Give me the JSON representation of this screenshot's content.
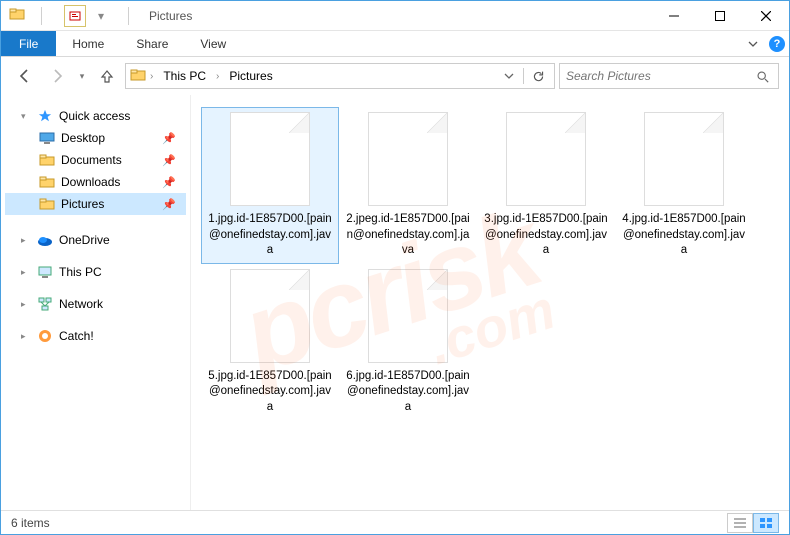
{
  "window": {
    "title": "Pictures"
  },
  "ribbon": {
    "file": "File",
    "tabs": [
      "Home",
      "Share",
      "View"
    ]
  },
  "address": {
    "crumbs": [
      "This PC",
      "Pictures"
    ]
  },
  "search": {
    "placeholder": "Search Pictures"
  },
  "sidebar": {
    "quick_access": {
      "label": "Quick access",
      "items": [
        {
          "label": "Desktop",
          "icon": "desktop",
          "pinned": true
        },
        {
          "label": "Documents",
          "icon": "folder",
          "pinned": true
        },
        {
          "label": "Downloads",
          "icon": "folder",
          "pinned": true
        },
        {
          "label": "Pictures",
          "icon": "folder",
          "pinned": true,
          "selected": true
        }
      ]
    },
    "roots": [
      {
        "label": "OneDrive",
        "icon": "onedrive"
      },
      {
        "label": "This PC",
        "icon": "thispc"
      },
      {
        "label": "Network",
        "icon": "network"
      },
      {
        "label": "Catch!",
        "icon": "catch"
      }
    ]
  },
  "files": [
    {
      "name": "1.jpg.id-1E857D00.[pain@onefinedstay.com].java",
      "selected": true
    },
    {
      "name": "2.jpeg.id-1E857D00.[pain@onefinedstay.com].java"
    },
    {
      "name": "3.jpg.id-1E857D00.[pain@onefinedstay.com].java"
    },
    {
      "name": "4.jpg.id-1E857D00.[pain@onefinedstay.com].java"
    },
    {
      "name": "5.jpg.id-1E857D00.[pain@onefinedstay.com].java"
    },
    {
      "name": "6.jpg.id-1E857D00.[pain@onefinedstay.com].java"
    }
  ],
  "status": {
    "count_label": "6 items"
  },
  "watermark": {
    "main": "pcrisk",
    "sub": ".com"
  }
}
